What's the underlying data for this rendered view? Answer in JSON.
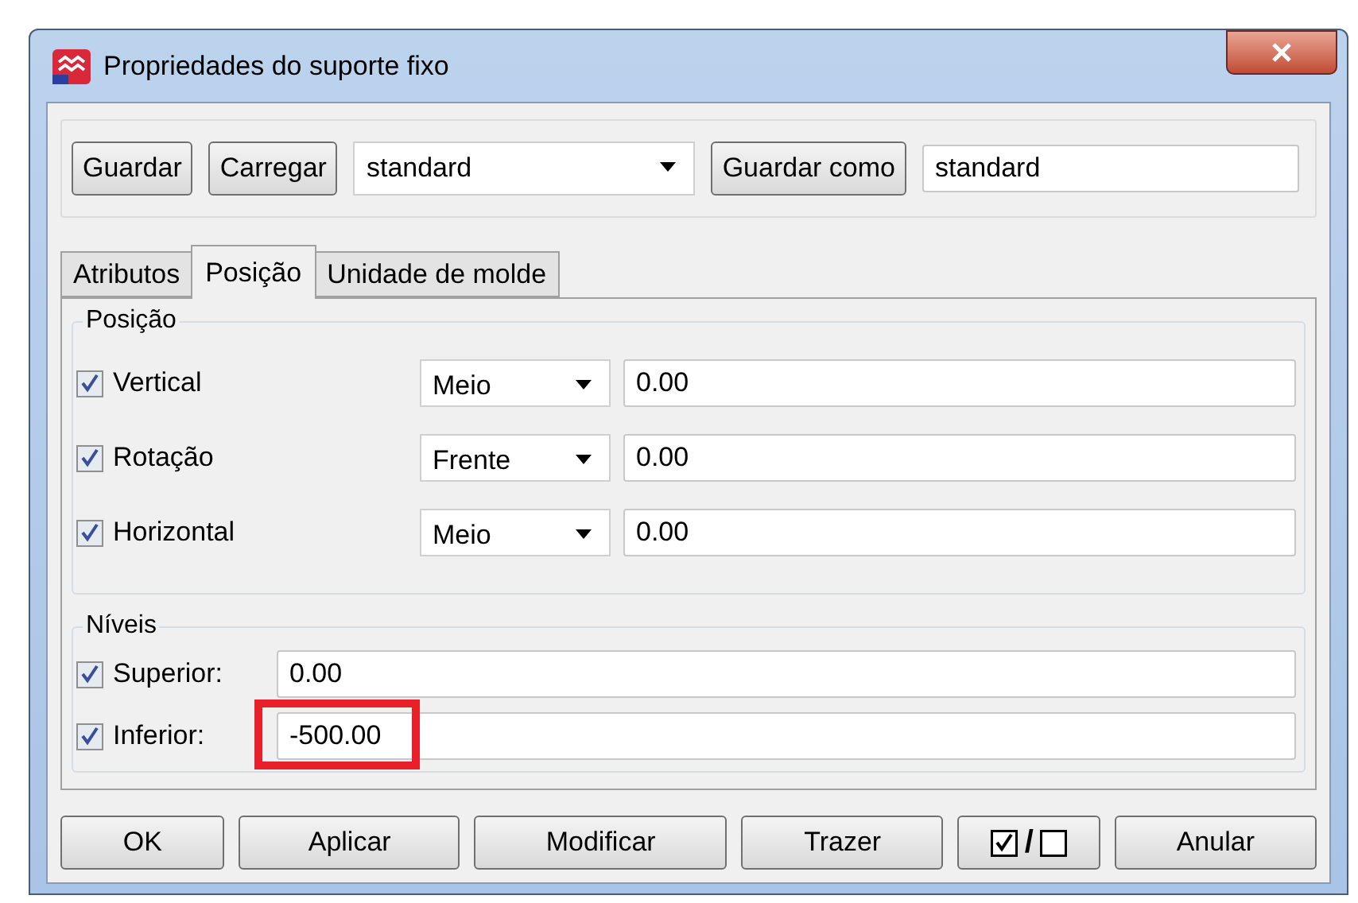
{
  "window": {
    "title": "Propriedades do suporte fixo"
  },
  "toolbar": {
    "buttons": [
      "Guardar",
      "Carregar"
    ],
    "preset": "standard",
    "save_as_button": "Guardar como",
    "save_as_name": "standard"
  },
  "tabs": [
    {
      "label": "Atributos",
      "selected": false
    },
    {
      "label": "Posição",
      "selected": true
    },
    {
      "label": "Unidade de molde",
      "selected": false
    }
  ],
  "position_group": {
    "title": "Posição",
    "rows": [
      {
        "label": "Vertical",
        "checked": true,
        "option": "Meio",
        "value": "0.00"
      },
      {
        "label": "Rotação",
        "checked": true,
        "option": "Frente",
        "value": "0.00"
      },
      {
        "label": "Horizontal",
        "checked": true,
        "option": "Meio",
        "value": "0.00"
      }
    ]
  },
  "levels_group": {
    "title": "Níveis",
    "rows": [
      {
        "label": "Superior:",
        "checked": true,
        "value": "0.00",
        "highlighted": false
      },
      {
        "label": "Inferior:",
        "checked": true,
        "value": "-500.00",
        "highlighted": true
      }
    ]
  },
  "buttons": [
    {
      "kind": "text",
      "label": "OK"
    },
    {
      "kind": "text",
      "label": "Aplicar"
    },
    {
      "kind": "text",
      "label": "Modificar"
    },
    {
      "kind": "text",
      "label": "Trazer"
    },
    {
      "kind": "toggle",
      "label": "/"
    },
    {
      "kind": "text",
      "label": "Anular"
    }
  ]
}
